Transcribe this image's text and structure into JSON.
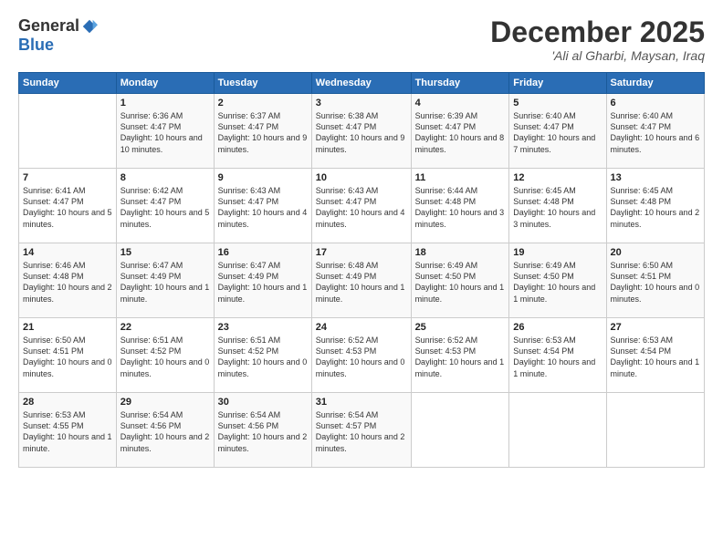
{
  "logo": {
    "general": "General",
    "blue": "Blue"
  },
  "title": {
    "month": "December 2025",
    "location": "'Ali al Gharbi, Maysan, Iraq"
  },
  "days_of_week": [
    "Sunday",
    "Monday",
    "Tuesday",
    "Wednesday",
    "Thursday",
    "Friday",
    "Saturday"
  ],
  "weeks": [
    [
      {
        "day": "",
        "sunrise": "",
        "sunset": "",
        "daylight": ""
      },
      {
        "day": "1",
        "sunrise": "Sunrise: 6:36 AM",
        "sunset": "Sunset: 4:47 PM",
        "daylight": "Daylight: 10 hours and 10 minutes."
      },
      {
        "day": "2",
        "sunrise": "Sunrise: 6:37 AM",
        "sunset": "Sunset: 4:47 PM",
        "daylight": "Daylight: 10 hours and 9 minutes."
      },
      {
        "day": "3",
        "sunrise": "Sunrise: 6:38 AM",
        "sunset": "Sunset: 4:47 PM",
        "daylight": "Daylight: 10 hours and 9 minutes."
      },
      {
        "day": "4",
        "sunrise": "Sunrise: 6:39 AM",
        "sunset": "Sunset: 4:47 PM",
        "daylight": "Daylight: 10 hours and 8 minutes."
      },
      {
        "day": "5",
        "sunrise": "Sunrise: 6:40 AM",
        "sunset": "Sunset: 4:47 PM",
        "daylight": "Daylight: 10 hours and 7 minutes."
      },
      {
        "day": "6",
        "sunrise": "Sunrise: 6:40 AM",
        "sunset": "Sunset: 4:47 PM",
        "daylight": "Daylight: 10 hours and 6 minutes."
      }
    ],
    [
      {
        "day": "7",
        "sunrise": "Sunrise: 6:41 AM",
        "sunset": "Sunset: 4:47 PM",
        "daylight": "Daylight: 10 hours and 5 minutes."
      },
      {
        "day": "8",
        "sunrise": "Sunrise: 6:42 AM",
        "sunset": "Sunset: 4:47 PM",
        "daylight": "Daylight: 10 hours and 5 minutes."
      },
      {
        "day": "9",
        "sunrise": "Sunrise: 6:43 AM",
        "sunset": "Sunset: 4:47 PM",
        "daylight": "Daylight: 10 hours and 4 minutes."
      },
      {
        "day": "10",
        "sunrise": "Sunrise: 6:43 AM",
        "sunset": "Sunset: 4:47 PM",
        "daylight": "Daylight: 10 hours and 4 minutes."
      },
      {
        "day": "11",
        "sunrise": "Sunrise: 6:44 AM",
        "sunset": "Sunset: 4:48 PM",
        "daylight": "Daylight: 10 hours and 3 minutes."
      },
      {
        "day": "12",
        "sunrise": "Sunrise: 6:45 AM",
        "sunset": "Sunset: 4:48 PM",
        "daylight": "Daylight: 10 hours and 3 minutes."
      },
      {
        "day": "13",
        "sunrise": "Sunrise: 6:45 AM",
        "sunset": "Sunset: 4:48 PM",
        "daylight": "Daylight: 10 hours and 2 minutes."
      }
    ],
    [
      {
        "day": "14",
        "sunrise": "Sunrise: 6:46 AM",
        "sunset": "Sunset: 4:48 PM",
        "daylight": "Daylight: 10 hours and 2 minutes."
      },
      {
        "day": "15",
        "sunrise": "Sunrise: 6:47 AM",
        "sunset": "Sunset: 4:49 PM",
        "daylight": "Daylight: 10 hours and 1 minute."
      },
      {
        "day": "16",
        "sunrise": "Sunrise: 6:47 AM",
        "sunset": "Sunset: 4:49 PM",
        "daylight": "Daylight: 10 hours and 1 minute."
      },
      {
        "day": "17",
        "sunrise": "Sunrise: 6:48 AM",
        "sunset": "Sunset: 4:49 PM",
        "daylight": "Daylight: 10 hours and 1 minute."
      },
      {
        "day": "18",
        "sunrise": "Sunrise: 6:49 AM",
        "sunset": "Sunset: 4:50 PM",
        "daylight": "Daylight: 10 hours and 1 minute."
      },
      {
        "day": "19",
        "sunrise": "Sunrise: 6:49 AM",
        "sunset": "Sunset: 4:50 PM",
        "daylight": "Daylight: 10 hours and 1 minute."
      },
      {
        "day": "20",
        "sunrise": "Sunrise: 6:50 AM",
        "sunset": "Sunset: 4:51 PM",
        "daylight": "Daylight: 10 hours and 0 minutes."
      }
    ],
    [
      {
        "day": "21",
        "sunrise": "Sunrise: 6:50 AM",
        "sunset": "Sunset: 4:51 PM",
        "daylight": "Daylight: 10 hours and 0 minutes."
      },
      {
        "day": "22",
        "sunrise": "Sunrise: 6:51 AM",
        "sunset": "Sunset: 4:52 PM",
        "daylight": "Daylight: 10 hours and 0 minutes."
      },
      {
        "day": "23",
        "sunrise": "Sunrise: 6:51 AM",
        "sunset": "Sunset: 4:52 PM",
        "daylight": "Daylight: 10 hours and 0 minutes."
      },
      {
        "day": "24",
        "sunrise": "Sunrise: 6:52 AM",
        "sunset": "Sunset: 4:53 PM",
        "daylight": "Daylight: 10 hours and 0 minutes."
      },
      {
        "day": "25",
        "sunrise": "Sunrise: 6:52 AM",
        "sunset": "Sunset: 4:53 PM",
        "daylight": "Daylight: 10 hours and 1 minute."
      },
      {
        "day": "26",
        "sunrise": "Sunrise: 6:53 AM",
        "sunset": "Sunset: 4:54 PM",
        "daylight": "Daylight: 10 hours and 1 minute."
      },
      {
        "day": "27",
        "sunrise": "Sunrise: 6:53 AM",
        "sunset": "Sunset: 4:54 PM",
        "daylight": "Daylight: 10 hours and 1 minute."
      }
    ],
    [
      {
        "day": "28",
        "sunrise": "Sunrise: 6:53 AM",
        "sunset": "Sunset: 4:55 PM",
        "daylight": "Daylight: 10 hours and 1 minute."
      },
      {
        "day": "29",
        "sunrise": "Sunrise: 6:54 AM",
        "sunset": "Sunset: 4:56 PM",
        "daylight": "Daylight: 10 hours and 2 minutes."
      },
      {
        "day": "30",
        "sunrise": "Sunrise: 6:54 AM",
        "sunset": "Sunset: 4:56 PM",
        "daylight": "Daylight: 10 hours and 2 minutes."
      },
      {
        "day": "31",
        "sunrise": "Sunrise: 6:54 AM",
        "sunset": "Sunset: 4:57 PM",
        "daylight": "Daylight: 10 hours and 2 minutes."
      },
      {
        "day": "",
        "sunrise": "",
        "sunset": "",
        "daylight": ""
      },
      {
        "day": "",
        "sunrise": "",
        "sunset": "",
        "daylight": ""
      },
      {
        "day": "",
        "sunrise": "",
        "sunset": "",
        "daylight": ""
      }
    ]
  ]
}
